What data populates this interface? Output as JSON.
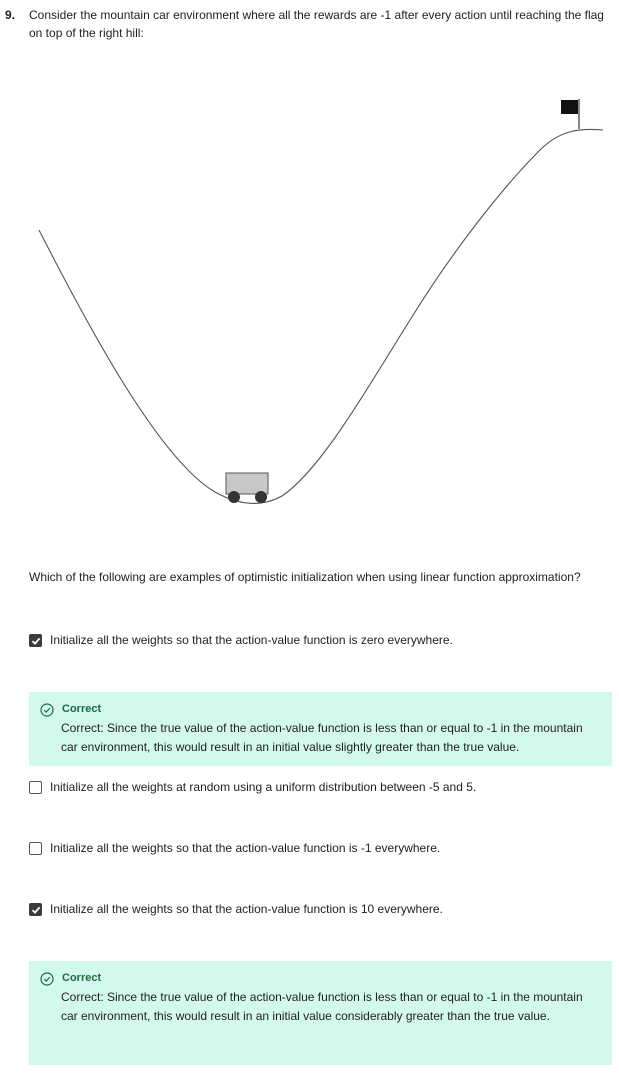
{
  "question": {
    "number": "9.",
    "text": "Consider the mountain car environment where all the rewards are -1 after every action until reaching the flag on top of the right hill:",
    "prompt": "Which of the following are examples of optimistic initialization when using linear function approximation?"
  },
  "figure": {
    "icons": [
      "mountain-curve",
      "cart-icon",
      "flag-icon"
    ]
  },
  "options": [
    {
      "label": "Initialize all the weights so that the action-value function is zero everywhere.",
      "checked": true,
      "feedback": {
        "icon": "check-circle-icon",
        "title": "Correct",
        "text": "Correct: Since the true value of the action-value function is less than or equal to -1 in the mountain car environment, this would result in an initial value slightly greater than the true value."
      }
    },
    {
      "label": "Initialize all the weights at random using a uniform distribution between -5 and 5.",
      "checked": false
    },
    {
      "label": "Initialize all the weights so that the action-value function is -1 everywhere.",
      "checked": false
    },
    {
      "label": "Initialize all the weights so that the action-value function is 10 everywhere.",
      "checked": true,
      "feedback": {
        "icon": "check-circle-icon",
        "title": "Correct",
        "text": "Correct: Since the true value of the action-value function is less than or equal to -1 in the mountain car environment, this would result in an initial value considerably greater than the true value."
      }
    }
  ],
  "colors": {
    "feedback_bg": "#d3f8ec",
    "correct_text": "#1d6b45",
    "checkbox_checked": "#3c3c3c"
  }
}
